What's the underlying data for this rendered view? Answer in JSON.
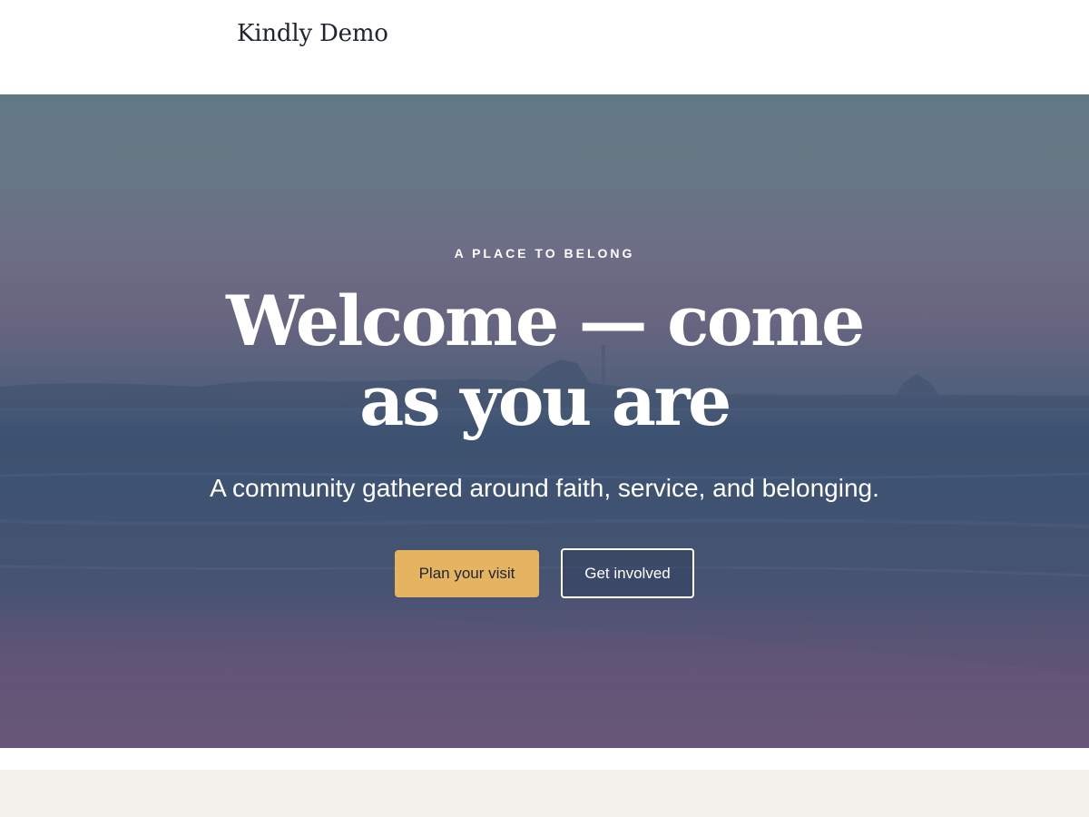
{
  "header": {
    "site_title": "Kindly Demo"
  },
  "hero": {
    "eyebrow": "A PLACE TO BELONG",
    "headline": "Welcome — come as you are",
    "subhead": "A community gathered around faith, service, and belonging.",
    "primary_button": "Plan your visit",
    "secondary_button": "Get involved",
    "background_image": "seascape-at-dusk"
  },
  "colors": {
    "accent": "#e5b460",
    "heading_text": "#1f2430",
    "section_background": "#f3f1ec"
  }
}
